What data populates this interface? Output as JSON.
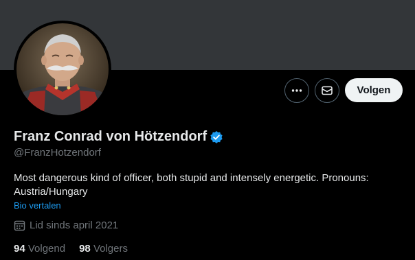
{
  "profile": {
    "name": "Franz Conrad von Hötzendorf",
    "handle": "@FranzHotzendorf",
    "bio": "Most dangerous kind of officer, both stupid and intensely energetic. Pronouns: Austria/Hungary",
    "translate_label": "Bio vertalen",
    "joined": "Lid sinds april 2021",
    "following_count": "94",
    "following_label": "Volgend",
    "followers_count": "98",
    "followers_label": "Volgers"
  },
  "actions": {
    "follow_label": "Volgen",
    "more_icon": "more-icon",
    "message_icon": "message-icon"
  },
  "colors": {
    "background": "#000000",
    "banner": "#333639",
    "accent": "#1d9bf0",
    "muted": "#71767b",
    "text": "#e7e9ea"
  }
}
